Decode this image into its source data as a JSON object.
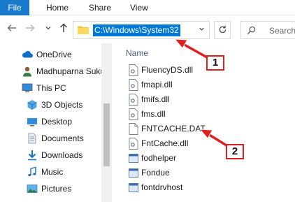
{
  "ribbon": {
    "tabs": [
      {
        "label": "File",
        "active": true
      },
      {
        "label": "Home"
      },
      {
        "label": "Share"
      },
      {
        "label": "View"
      }
    ]
  },
  "address_bar": {
    "path": "C:\\Windows\\System32",
    "selected": true
  },
  "search": {
    "placeholder": "Search"
  },
  "navigation": {
    "items": [
      {
        "label": "OneDrive",
        "icon": "cloud-icon"
      },
      {
        "label": "Madhuparna Suku",
        "icon": "user-icon"
      },
      {
        "label": "This PC",
        "icon": "computer-icon"
      },
      {
        "label": "3D Objects",
        "icon": "cube-icon"
      },
      {
        "label": "Desktop",
        "icon": "desktop-icon"
      },
      {
        "label": "Documents",
        "icon": "document-icon"
      },
      {
        "label": "Downloads",
        "icon": "download-icon"
      },
      {
        "label": "Music",
        "icon": "music-icon"
      },
      {
        "label": "Pictures",
        "icon": "pictures-icon"
      }
    ]
  },
  "file_list": {
    "column_header": "Name",
    "files": [
      {
        "name": "FluencyDS.dll",
        "icon": "dll-file-icon"
      },
      {
        "name": "fmapi.dll",
        "icon": "dll-file-icon"
      },
      {
        "name": "fmifs.dll",
        "icon": "dll-file-icon"
      },
      {
        "name": "fms.dll",
        "icon": "dll-file-icon"
      },
      {
        "name": "FNTCACHE.DAT",
        "icon": "blank-file-icon"
      },
      {
        "name": "FntCache.dll",
        "icon": "dll-file-icon"
      },
      {
        "name": "fodhelper",
        "icon": "exe-file-icon"
      },
      {
        "name": "Fondue",
        "icon": "exe-file-icon"
      },
      {
        "name": "fontdrvhost",
        "icon": "exe-file-icon"
      }
    ]
  },
  "annotations": {
    "step1_label": "1",
    "step2_label": "2",
    "color": "#e02020"
  },
  "colors": {
    "accent": "#0078d7",
    "file_tab": "#1979ca",
    "annotation": "#e02020"
  }
}
